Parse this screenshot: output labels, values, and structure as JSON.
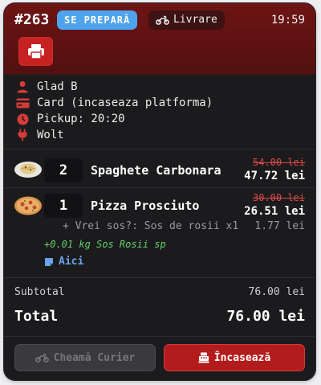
{
  "order": {
    "number": "#263",
    "status": "SE PREPARĂ",
    "type_label": "Livrare",
    "time": "19:59"
  },
  "customer": {
    "name": "Glad B",
    "payment": "Card (incaseaza platforma)",
    "pickup": "Pickup: 20:20",
    "platform": "Wolt"
  },
  "items": [
    {
      "qty": "2",
      "name": "Spaghete Carbonara",
      "old_price": "54.00 lei",
      "price": "47.72 lei",
      "dish_icon": "pasta-plate-icon"
    },
    {
      "qty": "1",
      "name": "Pizza Prosciuto",
      "old_price": "30.00 lei",
      "price": "26.51 lei",
      "dish_icon": "pizza-icon",
      "option": "+ Vrei sos?: Sos de rosii x1",
      "option_price": "1.77 lei",
      "extra": "+0.01 kg Sos Rosii sp",
      "note_label": "Aici"
    }
  ],
  "totals": {
    "subtotal_label": "Subtotal",
    "subtotal": "76.00 lei",
    "total_label": "Total",
    "total": "76.00 lei"
  },
  "actions": {
    "courier_label": "Cheamă Curier",
    "collect_label": "Încasează"
  },
  "colors": {
    "header": "#6e1414",
    "badge": "#4ea3ee",
    "primary_button": "#b31c1c",
    "strike_price": "#d84848",
    "extra_text": "#62d06a",
    "note_text": "#6aa4ec"
  }
}
